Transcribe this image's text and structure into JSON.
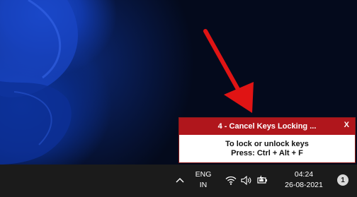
{
  "popup": {
    "title": "4 - Cancel Keys Locking ...",
    "close_label": "X",
    "line1": "To lock or unlock keys",
    "line2": "Press: Ctrl + Alt + F"
  },
  "taskbar": {
    "lang_primary": "ENG",
    "lang_secondary": "IN",
    "time": "04:24",
    "date": "26-08-2021",
    "notification_count": "1"
  },
  "colors": {
    "popup_header": "#b0161c",
    "arrow": "#e01414",
    "taskbar": "#1b1b1b"
  },
  "icons": [
    "chevron-up-icon",
    "wifi-icon",
    "volume-icon",
    "battery-charging-icon"
  ]
}
